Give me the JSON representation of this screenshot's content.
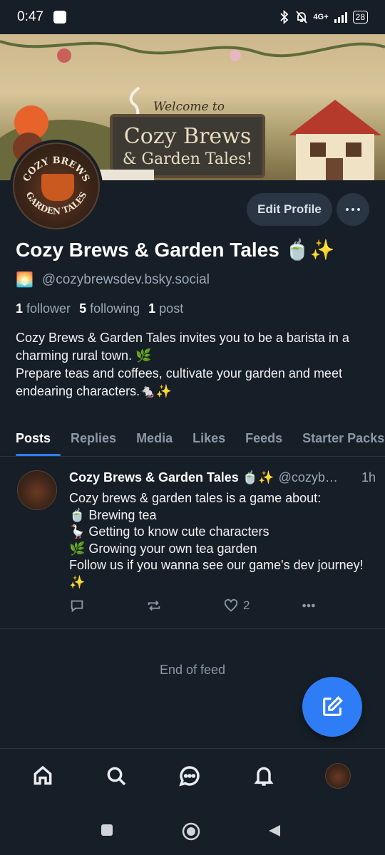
{
  "status_bar": {
    "time": "0:47",
    "network": "4G+",
    "battery": "28"
  },
  "banner": {
    "welcome": "Welcome to",
    "line1": "Cozy Brews",
    "line2": "& Garden Tales!"
  },
  "avatar_text": {
    "top": "COZY BREWS",
    "bottom": "GARDEN TALES"
  },
  "profile": {
    "edit_label": "Edit Profile",
    "display_name": "Cozy Brews & Garden Tales 🍵✨",
    "handle_emoji": "🌅",
    "handle": "@cozybrewsdev.bsky.social",
    "followers_count": "1",
    "followers_label": "follower",
    "following_count": "5",
    "following_label": "following",
    "posts_count": "1",
    "posts_label": "post",
    "bio_line1": "Cozy Brews & Garden Tales invites you to be a barista in a charming rural town. 🌿",
    "bio_line2": "Prepare teas and coffees, cultivate your garden and meet endearing characters.🐁✨"
  },
  "tabs": [
    {
      "label": "Posts"
    },
    {
      "label": "Replies"
    },
    {
      "label": "Media"
    },
    {
      "label": "Likes"
    },
    {
      "label": "Feeds"
    },
    {
      "label": "Starter Packs"
    }
  ],
  "post": {
    "author": "Cozy Brews & Garden Tales 🍵✨",
    "handle": "@cozyb…",
    "time": "1h",
    "text": "Cozy brews & garden tales is a game about:\n🍵 Brewing tea\n🪿 Getting to know cute characters\n🌿 Growing your own tea garden\nFollow us if you wanna see our game's dev journey!✨",
    "likes": "2"
  },
  "feed_end": "End of feed",
  "colors": {
    "background": "#161e27",
    "accent": "#2f7df6",
    "muted": "#8b98a6"
  },
  "icons": {
    "nav": [
      "home-icon",
      "search-icon",
      "chat-icon",
      "bell-icon",
      "profile-avatar"
    ],
    "fab": "compose-icon"
  }
}
